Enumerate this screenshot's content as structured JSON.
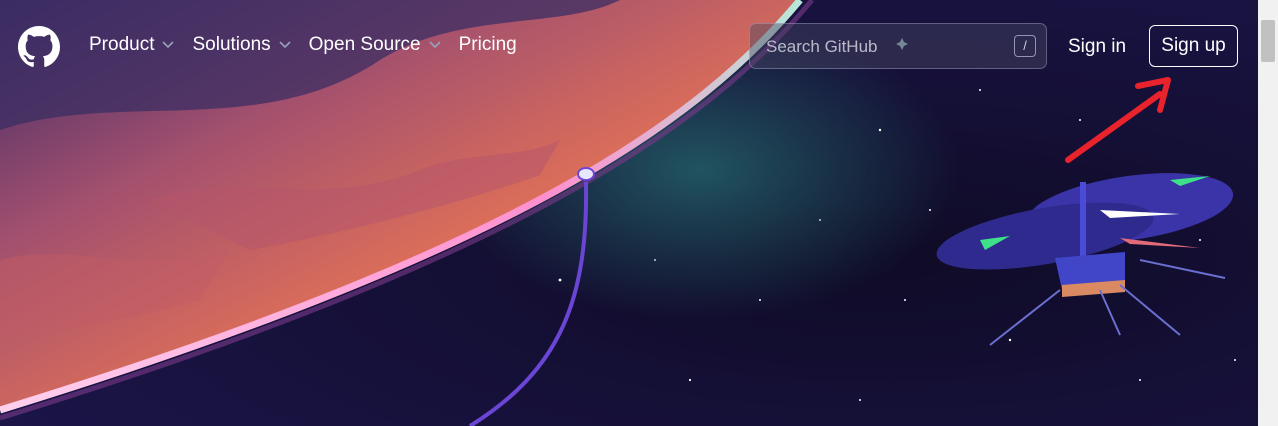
{
  "nav": {
    "logo_icon": "github-mark-icon",
    "items": [
      {
        "label": "Product",
        "has_dropdown": true
      },
      {
        "label": "Solutions",
        "has_dropdown": true
      },
      {
        "label": "Open Source",
        "has_dropdown": true
      },
      {
        "label": "Pricing",
        "has_dropdown": false
      }
    ],
    "search": {
      "placeholder": "Search GitHub",
      "shortcut": "/"
    },
    "signin_label": "Sign in",
    "signup_label": "Sign up"
  },
  "annotation": {
    "icon": "red-arrow-icon",
    "color": "#e8232b"
  },
  "colors": {
    "space": "#100c2c",
    "planet": "#e8775a",
    "horizon": "#ff9bd0",
    "rim": "#43c9a0",
    "tether": "#6b46d6",
    "drone": "#3a34a8"
  }
}
